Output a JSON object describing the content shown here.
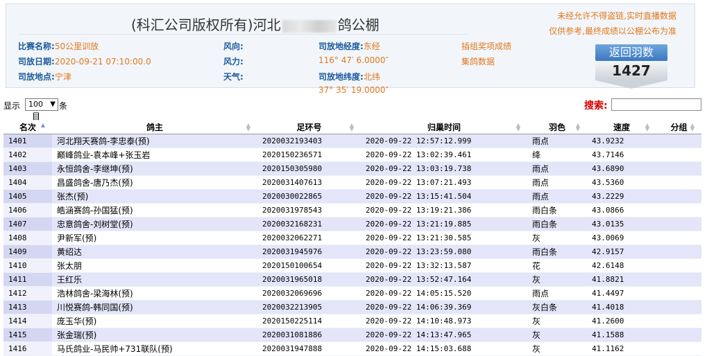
{
  "header": {
    "title_prefix": "(科汇公司版权所有)河北",
    "title_suffix": "鸽公棚",
    "notice_line1": "未经允许不得盗链,实时直播数据",
    "notice_line2": "仅供参考,最终成绩以公棚公布为准",
    "race_name_label": "比赛名称:",
    "race_name": "50公里训放",
    "release_date_label": "司放日期:",
    "release_date": "2020-09-21 07:10:00.0",
    "release_place_label": "司放地点:",
    "release_place": "宁津",
    "wind_dir_label": "风向:",
    "wind_dir": "",
    "wind_force_label": "风力:",
    "wind_force": "",
    "weather_label": "天气:",
    "weather": "",
    "longitude_label": "司放地经度:",
    "longitude_dir": "东经",
    "longitude_value": "116° 47′ 6.0000″",
    "latitude_label": "司放地纬度:",
    "latitude_dir": "北纬",
    "latitude_value": "37° 35′ 19.0000″",
    "link_group_awards": "插组奖项成绩",
    "link_collect": "集鸽数据",
    "badge_label": "返回羽数",
    "badge_value": "1427"
  },
  "controls": {
    "show_label": "显示",
    "page_size": "100",
    "show_unit": "条",
    "show_sub": "目",
    "search_label": "搜索:",
    "search_value": ""
  },
  "colors": {
    "accent_orange": "#e0781e",
    "label_blue": "#1b5a9c",
    "search_red": "#d40000",
    "row_stripe": "#e3e6f9"
  },
  "table": {
    "columns": [
      "名次",
      "鸽主",
      "足环号",
      "归巢时间",
      "羽色",
      "速度",
      "分组"
    ],
    "rows": [
      [
        "1401",
        "河北翔天赛鸽-李忠泰(预)",
        "2020032193403",
        "2020-09-22 12:57:12.999",
        "雨点",
        "43.9232",
        ""
      ],
      [
        "1402",
        "巅峰鸽业-袁本峰+张玉岩",
        "2020150236571",
        "2020-09-22 13:02:39.461",
        "绛",
        "43.7146",
        ""
      ],
      [
        "1403",
        "永恒鸽舍-李继坤(预)",
        "2020150305980",
        "2020-09-22 13:03:19.738",
        "雨点",
        "43.6890",
        ""
      ],
      [
        "1404",
        "昌盛鸽舍-唐乃杰(预)",
        "2020031407613",
        "2020-09-22 13:07:21.493",
        "雨点",
        "43.5360",
        ""
      ],
      [
        "1405",
        "张杰(预)",
        "2020030022865",
        "2020-09-22 13:15:41.504",
        "雨点",
        "43.2229",
        ""
      ],
      [
        "1406",
        "皓涵赛鸽-孙国猛(预)",
        "2020031978543",
        "2020-09-22 13:19:21.386",
        "雨白条",
        "43.0866",
        ""
      ],
      [
        "1407",
        "忠意鸽舍-刘树堂(预)",
        "2020032168231",
        "2020-09-22 13:21:19.885",
        "雨白条",
        "43.0135",
        ""
      ],
      [
        "1408",
        "尹新军(预)",
        "2020032062271",
        "2020-09-22 13:21:30.585",
        "灰",
        "43.0069",
        ""
      ],
      [
        "1409",
        "黄绍达",
        "2020031945976",
        "2020-09-22 13:23:59.080",
        "雨白条",
        "42.9157",
        ""
      ],
      [
        "1410",
        "张太朋",
        "2020150100654",
        "2020-09-22 13:32:13.587",
        "花",
        "42.6148",
        ""
      ],
      [
        "1411",
        "王红乐",
        "2020031965018",
        "2020-09-22 13:52:47.164",
        "灰",
        "41.8821",
        ""
      ],
      [
        "1412",
        "浩林鸽舍-梁海林(预)",
        "2020032069696",
        "2020-09-22 14:05:15.520",
        "雨点",
        "41.4497",
        ""
      ],
      [
        "1413",
        "川悦赛鸽-韩同国(预)",
        "2020032213905",
        "2020-09-22 14:06:39.369",
        "灰白条",
        "41.4018",
        ""
      ],
      [
        "1414",
        "庞玉华(预)",
        "2020150225114",
        "2020-09-22 14:10:48.973",
        "灰",
        "41.2600",
        ""
      ],
      [
        "1415",
        "张金瑞(预)",
        "2020031081886",
        "2020-09-22 14:13:47.965",
        "灰",
        "41.1588",
        ""
      ],
      [
        "1416",
        "马氏鸽业-马民帅+731联队(预)",
        "2020031947888",
        "2020-09-22 14:15:03.688",
        "灰",
        "41.1162",
        ""
      ]
    ]
  }
}
